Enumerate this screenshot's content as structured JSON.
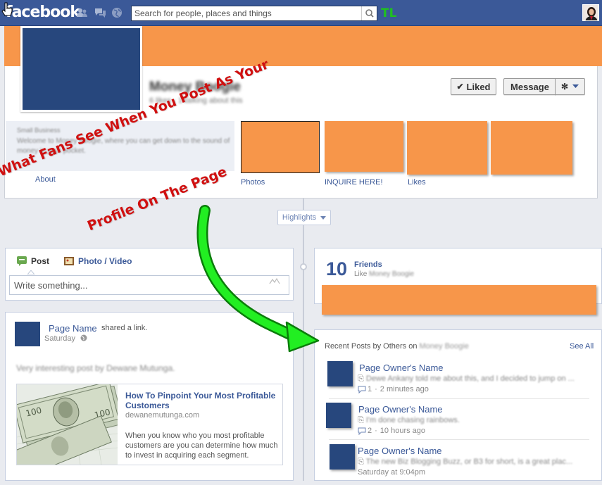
{
  "topbar": {
    "logo": "facebook",
    "search_placeholder": "Search for people, places and things",
    "tl_label": "TL"
  },
  "colors": {
    "brand_blue": "#3b5998",
    "cover_orange": "#f7964a",
    "annotation_red": "#d01010",
    "arrow_green": "#22ee22"
  },
  "header": {
    "page_name": "Money Boogie",
    "page_sub": "6 likes · 1 talking about this",
    "liked_label": "Liked",
    "message_label": "Message",
    "about_category": "Small Business",
    "about_text": "Welcome to Money Boogie, where you can get down to the sound of money in your pocket.",
    "about_link": "About",
    "apps": [
      "Photos",
      "INQUIRE HERE!",
      "Likes"
    ]
  },
  "annotation": {
    "line1": "What Fans See When You Post As Your",
    "line2": "Profile On The Page"
  },
  "highlights_label": "Highlights",
  "composer": {
    "post_tab": "Post",
    "photo_tab": "Photo / Video",
    "placeholder": "Write something..."
  },
  "post": {
    "author": "Page Name",
    "action": "shared a link.",
    "time": "Saturday",
    "text": "Very interesting post by Dewane Mutunga.",
    "link_title": "How To Pinpoint Your Most Profitable Customers",
    "link_domain": "dewanemutunga.com",
    "link_desc": "When you know who you most profitable customers are you can determine how much to invest in acquiring each segment."
  },
  "friends": {
    "count": "10",
    "label": "Friends",
    "like_prefix": "Like",
    "like_name": "Money Boogie"
  },
  "recent": {
    "title": "Recent Posts by Others on",
    "page_name": "Money Boogie",
    "see_all": "See All",
    "items": [
      {
        "name": "Page Owner's Name",
        "snippet": "Dewe Ankany told me about this, and I decided to jump on ...",
        "comments": "1",
        "time": "2 minutes ago"
      },
      {
        "name": "Page Owner's Name",
        "snippet": "I'm done chasing rainbows.",
        "comments": "2",
        "time": "10 hours ago"
      },
      {
        "name": "Page Owner's Name",
        "snippet": "The new Biz Blogging Buzz, or B3 for short, is a great plac...",
        "comments": "",
        "time": "Saturday at 9:04pm"
      }
    ]
  }
}
